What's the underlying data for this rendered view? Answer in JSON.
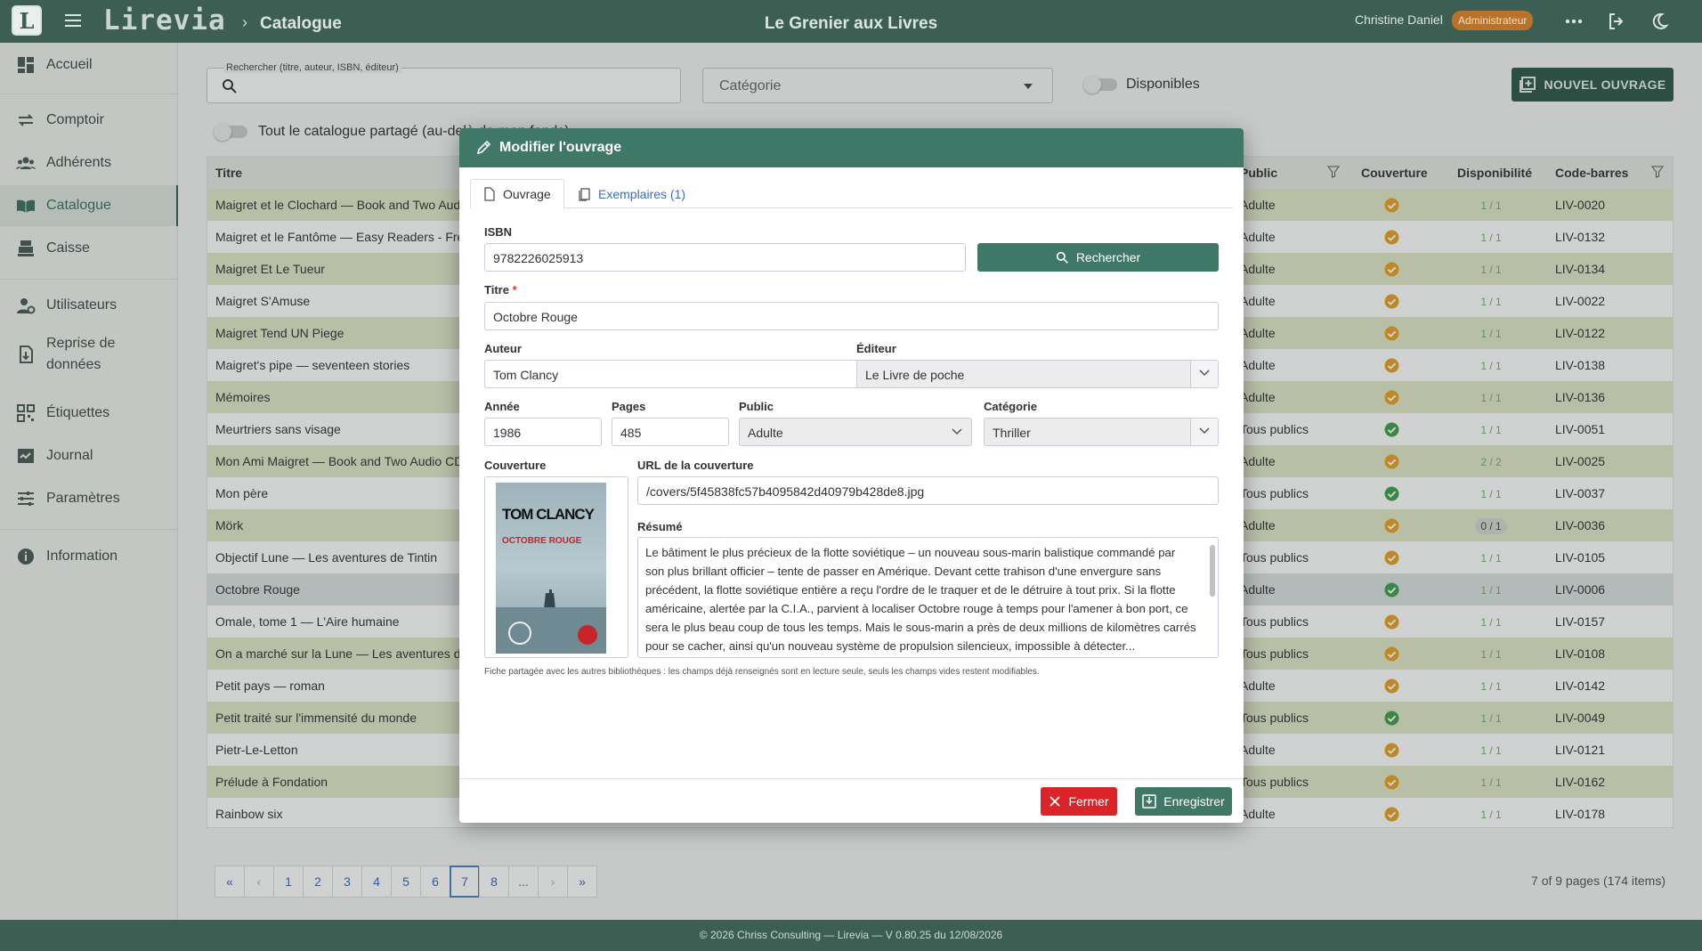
{
  "header": {
    "logo": "L",
    "brand": "Lirevia",
    "breadcrumb": "Catalogue",
    "site_name": "Le Grenier aux Livres",
    "user_name": "Christine Daniel",
    "role_badge": "Administrateur"
  },
  "sidebar": {
    "items": [
      {
        "label": "Accueil",
        "icon": "dashboard-icon"
      },
      {
        "label": "Comptoir",
        "icon": "exchange-icon"
      },
      {
        "label": "Adhérents",
        "icon": "users-icon"
      },
      {
        "label": "Catalogue",
        "icon": "book-icon",
        "active": true
      },
      {
        "label": "Caisse",
        "icon": "cash-register-icon"
      },
      {
        "label": "Utilisateurs",
        "icon": "user-gear-icon"
      },
      {
        "label": "Reprise de données",
        "icon": "file-import-icon"
      },
      {
        "label": "Étiquettes",
        "icon": "qrcode-icon"
      },
      {
        "label": "Journal",
        "icon": "journal-icon"
      },
      {
        "label": "Paramètres",
        "icon": "sliders-icon"
      },
      {
        "label": "Information",
        "icon": "info-icon"
      }
    ]
  },
  "toolbar": {
    "search_label": "Rechercher (titre, auteur, ISBN, éditeur)",
    "category_placeholder": "Catégorie",
    "available_label": "Disponibles",
    "new_button": "NOUVEL OUVRAGE",
    "shared_catalogue_label": "Tout le catalogue partagé (au-delà de mon fonds)"
  },
  "table": {
    "columns": {
      "title": "Titre",
      "public": "Public",
      "cover": "Couverture",
      "availability": "Disponibilité",
      "barcode": "Code-barres"
    },
    "rows": [
      {
        "title": "Maigret et le Clochard — Book and Two Audio CDs",
        "public": "Adulte",
        "cover": "orange",
        "avail": "1 / 1",
        "barcode": "LIV-0020"
      },
      {
        "title": "Maigret et le Fantôme — Easy Readers - French",
        "public": "Adulte",
        "cover": "orange",
        "avail": "1 / 1",
        "barcode": "LIV-0132"
      },
      {
        "title": "Maigret Et Le Tueur",
        "public": "Adulte",
        "cover": "orange",
        "avail": "1 / 1",
        "barcode": "LIV-0134"
      },
      {
        "title": "Maigret S'Amuse",
        "public": "Adulte",
        "cover": "orange",
        "avail": "1 / 1",
        "barcode": "LIV-0022"
      },
      {
        "title": "Maigret Tend UN Piege",
        "public": "Adulte",
        "cover": "orange",
        "avail": "1 / 1",
        "barcode": "LIV-0122"
      },
      {
        "title": "Maigret's pipe — seventeen stories",
        "public": "Adulte",
        "cover": "orange",
        "avail": "1 / 1",
        "barcode": "LIV-0138"
      },
      {
        "title": "Mémoires",
        "public": "Adulte",
        "cover": "orange",
        "avail": "1 / 1",
        "barcode": "LIV-0136"
      },
      {
        "title": "Meurtriers sans visage",
        "public": "Tous publics",
        "cover": "green",
        "avail": "1 / 1",
        "barcode": "LIV-0051"
      },
      {
        "title": "Mon Ami Maigret — Book and Two Audio CDs",
        "public": "Adulte",
        "cover": "orange",
        "avail": "2 / 2",
        "barcode": "LIV-0025"
      },
      {
        "title": "Mon père",
        "public": "Tous publics",
        "cover": "green",
        "avail": "1 / 1",
        "barcode": "LIV-0037"
      },
      {
        "title": "Mörk",
        "public": "Adulte",
        "cover": "orange",
        "avail": "0 / 1",
        "barcode": "LIV-0036"
      },
      {
        "title": "Objectif Lune — Les aventures de Tintin",
        "public": "Tous publics",
        "cover": "orange",
        "avail": "1 / 1",
        "barcode": "LIV-0105"
      },
      {
        "title": "Octobre Rouge",
        "public": "Adulte",
        "cover": "green",
        "avail": "1 / 1",
        "barcode": "LIV-0006"
      },
      {
        "title": "Omale, tome 1 — L'Aire humaine",
        "public": "Tous publics",
        "cover": "orange",
        "avail": "1 / 1",
        "barcode": "LIV-0157"
      },
      {
        "title": "On a marché sur la Lune — Les aventures de Tintin",
        "public": "Tous publics",
        "cover": "orange",
        "avail": "1 / 1",
        "barcode": "LIV-0108"
      },
      {
        "title": "Petit pays — roman",
        "public": "Adulte",
        "cover": "orange",
        "avail": "1 / 1",
        "barcode": "LIV-0142"
      },
      {
        "title": "Petit traité sur l'immensité du monde",
        "public": "Tous publics",
        "cover": "green",
        "avail": "1 / 1",
        "barcode": "LIV-0049"
      },
      {
        "title": "Pietr-Le-Letton",
        "public": "Adulte",
        "cover": "orange",
        "avail": "1 / 1",
        "barcode": "LIV-0121"
      },
      {
        "title": "Prélude à Fondation",
        "public": "Tous publics",
        "cover": "orange",
        "avail": "1 / 1",
        "barcode": "LIV-0162"
      },
      {
        "title": "Rainbow six",
        "public": "Adulte",
        "cover": "orange",
        "avail": "1 / 1",
        "barcode": "LIV-0178"
      }
    ],
    "pager": {
      "pages": [
        "«",
        "‹",
        "1",
        "2",
        "3",
        "4",
        "5",
        "6",
        "7",
        "8",
        "...",
        "›",
        "»"
      ],
      "current": "7",
      "info": "7 of 9 pages (174 items)"
    }
  },
  "modal": {
    "title": "Modifier l'ouvrage",
    "tabs": [
      "Ouvrage",
      "Exemplaires (1)"
    ],
    "fields": {
      "isbn_label": "ISBN",
      "isbn": "9782226025913",
      "search_button": "Rechercher",
      "title_label": "Titre",
      "title": "Octobre Rouge",
      "author_label": "Auteur",
      "author": "Tom Clancy",
      "publisher_label": "Éditeur",
      "publisher": "Le Livre de poche",
      "year_label": "Année",
      "year": "1986",
      "pages_label": "Pages",
      "pages": "485",
      "public_label": "Public",
      "public": "Adulte",
      "category_label": "Catégorie",
      "category": "Thriller",
      "cover_label": "Couverture",
      "cover_url_label": "URL de la couverture",
      "cover_url": "/covers/5f45838fc57b4095842d40979b428de8.jpg",
      "summary_label": "Résumé",
      "summary": "Le bâtiment le plus précieux de la flotte soviétique – un nouveau sous-marin balistique commandé par son plus brillant officier – tente de passer en Amérique. Devant cette trahison d'une envergure sans précédent, la flotte soviétique entière a reçu l'ordre de le traquer et de le détruire à tout prix. Si la flotte américaine, alertée par la C.I.A., parvient à localiser Octobre rouge à temps pour l'amener à bon port, ce sera le plus beau coup de tous les temps. Mais le sous-marin a près de deux millions de kilomètres carrés pour se cacher, ainsi qu'un nouveau système de propulsion silencieux, impossible à détecter..."
    },
    "cover_book": {
      "author": "TOM CLANCY",
      "title": "OCTOBRE ROUGE"
    },
    "note": "Fiche partagée avec les autres bibliothèques : les champs déjà renseignés sont en lecture seule, seuls les champs vides restent modifiables.",
    "close_button": "Fermer",
    "save_button": "Enregistrer"
  },
  "footer": "© 2026 Chriss Consulting — Lirevia — V 0.80.25 du 12/08/2026",
  "colors": {
    "primary": "#3d5f53",
    "modal_header": "#3f7867",
    "row_alt": "#e2e7c9",
    "cover_ok": "#3aa04a",
    "cover_warn": "#e8a020",
    "danger": "#d9242a"
  }
}
